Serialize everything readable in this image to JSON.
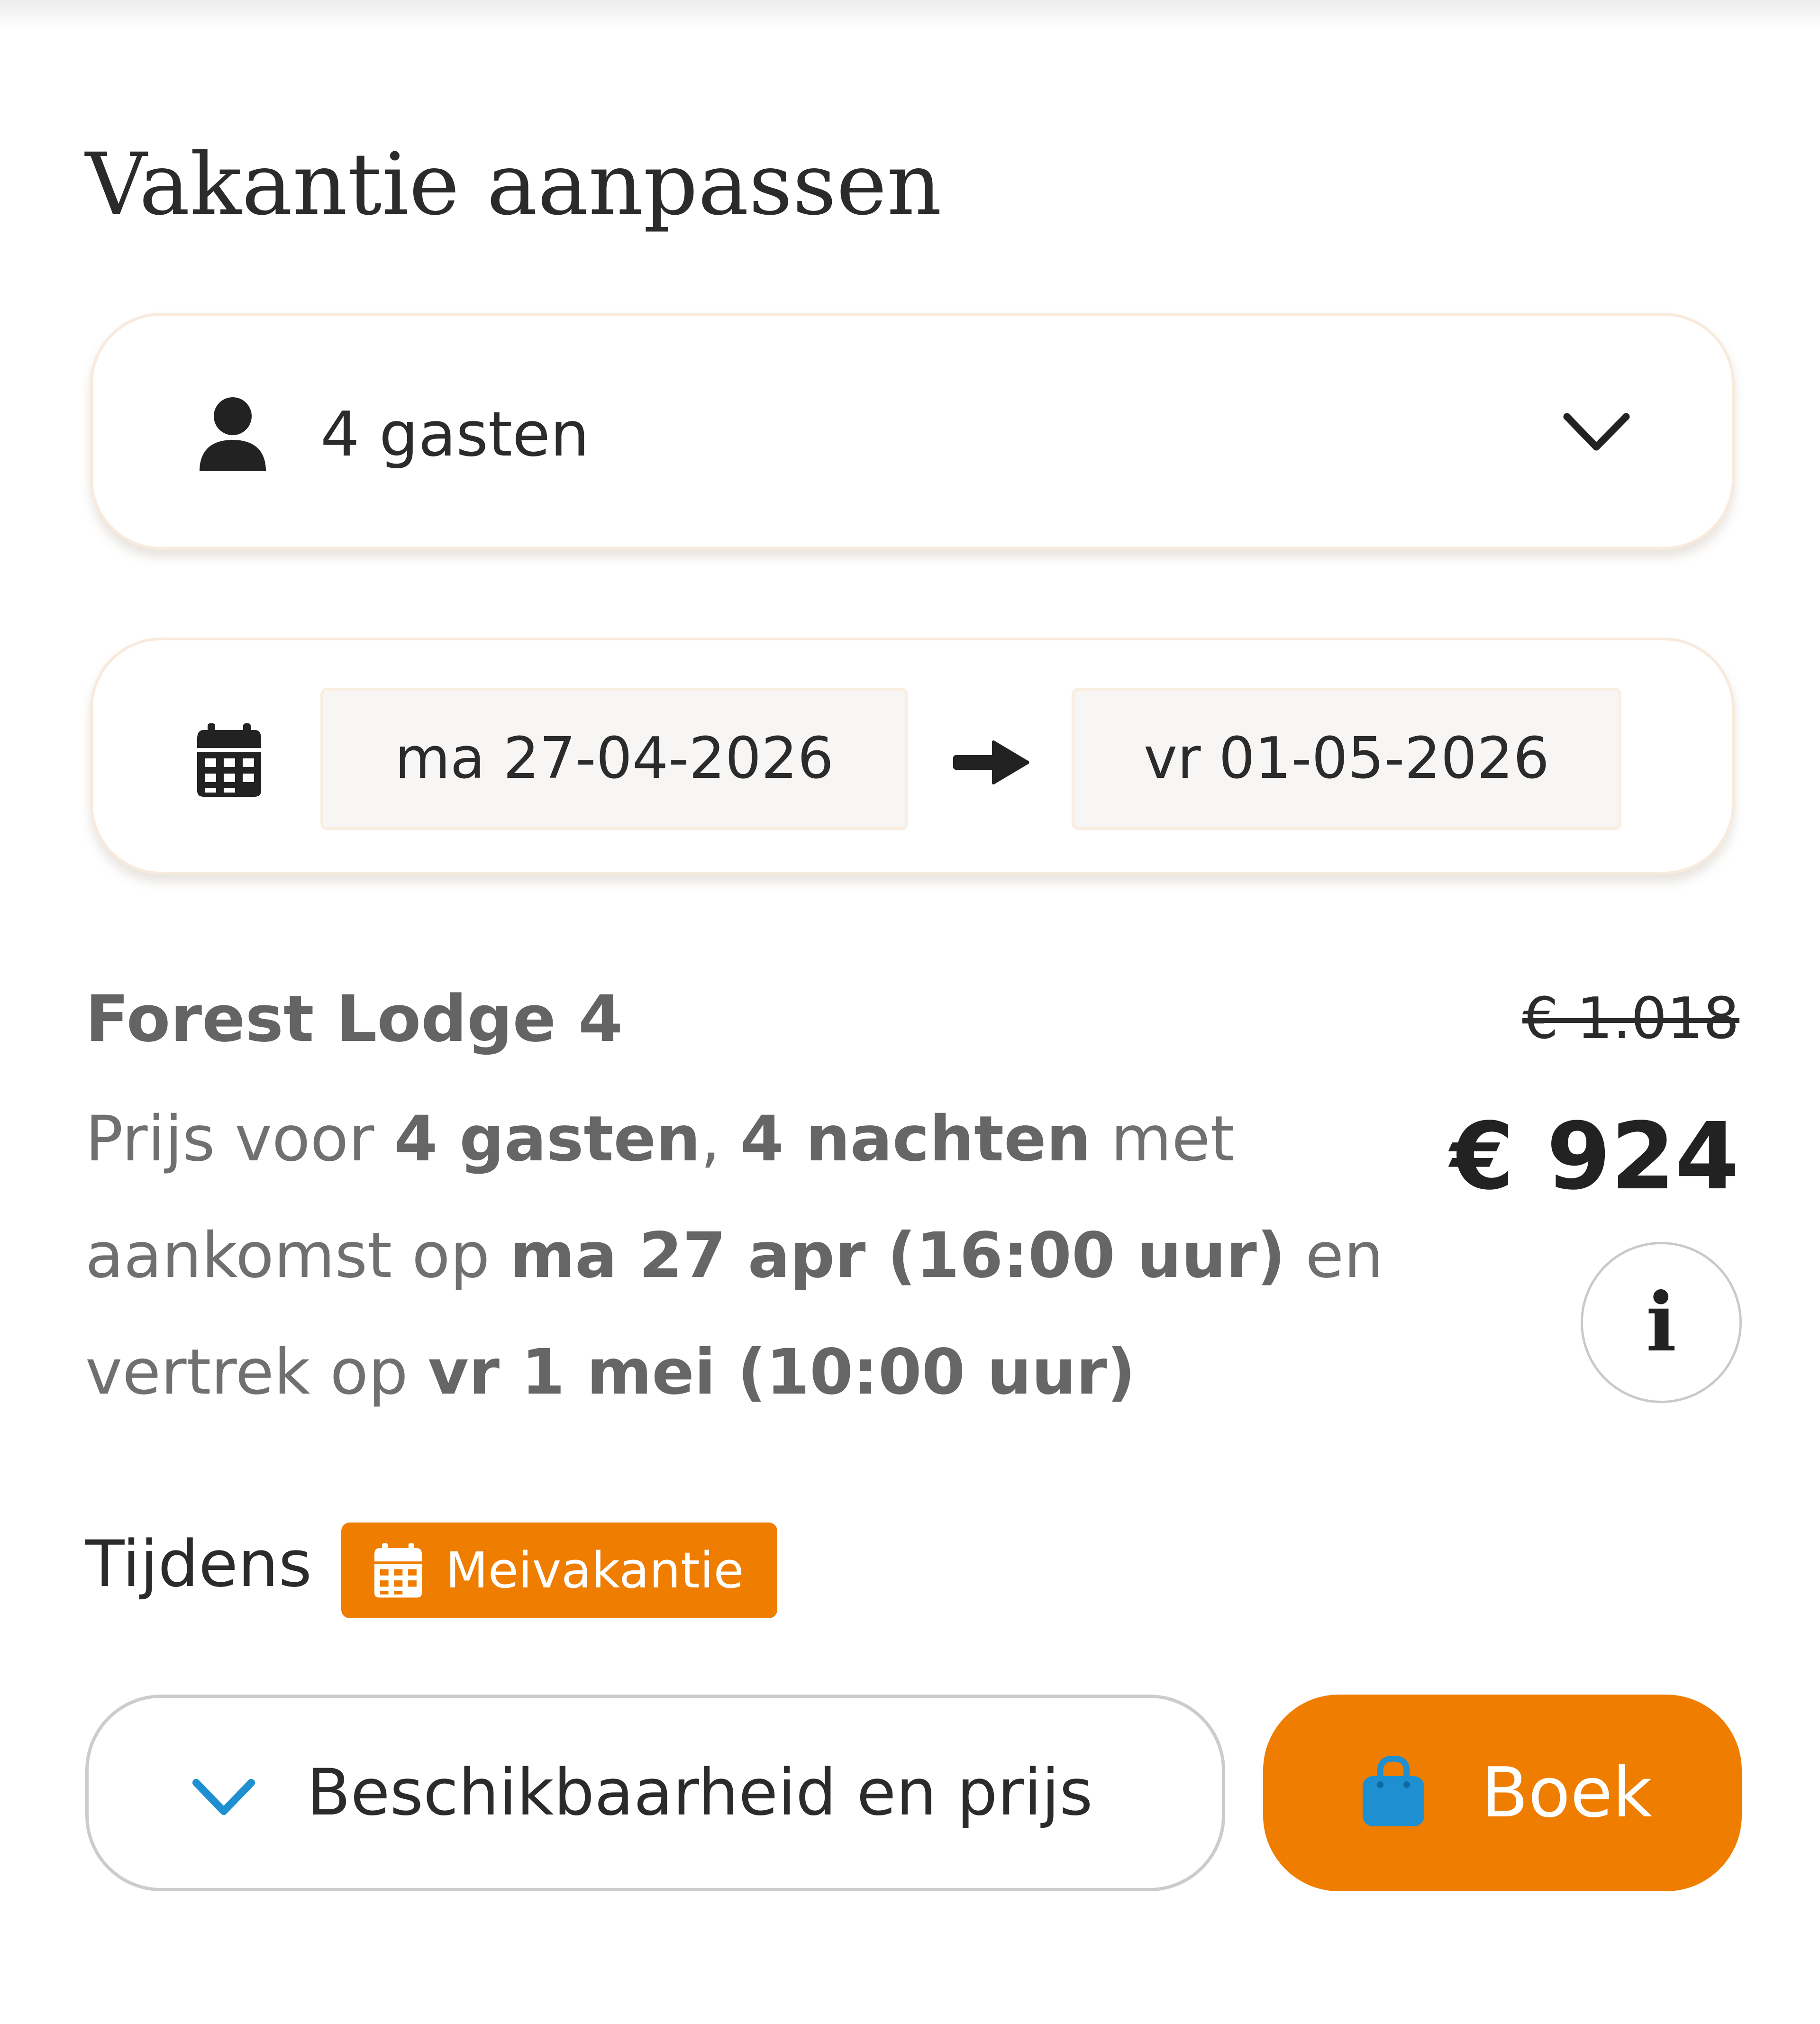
{
  "heading": "Vakantie aanpassen",
  "guests": {
    "label": "4 gasten",
    "icon": "user-icon",
    "toggle_icon": "chevron-down-icon"
  },
  "dates": {
    "icon": "calendar-icon",
    "arrival": "ma 27-04-2026",
    "separator_icon": "arrow-right-icon",
    "departure": "vr 01-05-2026"
  },
  "accommodation": {
    "name": "Forest Lodge 4",
    "description": {
      "prefix": "Prijs voor ",
      "guests": "4 gasten",
      "comma": ", ",
      "nights": "4 nachten",
      "mid1": " met aankomst op ",
      "arrival": "ma 27 apr (16:00 uur)",
      "mid2": " en vertrek op ",
      "departure": "vr 1 mei (10:00 uur)"
    },
    "price_old": "€ 1.018",
    "price_new": "€ 924",
    "info_label": "i"
  },
  "season": {
    "prefix": "Tijdens",
    "badge": "Meivakantie",
    "badge_icon": "calendar-icon"
  },
  "actions": {
    "availability_label": "Beschikbaarheid en prijs",
    "availability_icon": "chevron-down-icon",
    "book_label": "Boek",
    "book_icon": "shopping-bag-icon"
  },
  "colors": {
    "accent_orange": "#EF7D00",
    "link_blue": "#1E8FD0",
    "text_dark": "#2B2B2B",
    "text_muted": "#707070",
    "card_border": "#F8EADC"
  }
}
